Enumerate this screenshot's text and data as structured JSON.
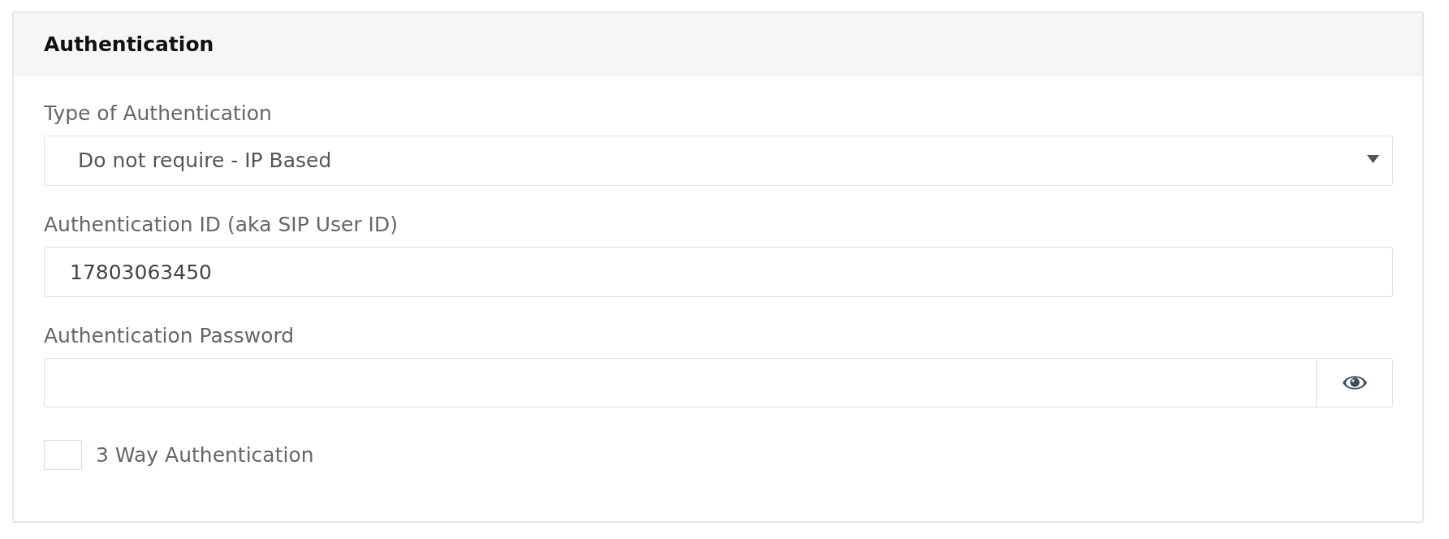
{
  "card": {
    "title": "Authentication"
  },
  "fields": [
    {
      "kind": "select",
      "label": "Type of Authentication",
      "value": "Do not require - IP Based"
    },
    {
      "kind": "text",
      "label": "Authentication ID (aka SIP User ID)",
      "value": "17803063450"
    },
    {
      "kind": "password",
      "label": "Authentication Password"
    }
  ],
  "checkbox": {
    "label": "3 Way Authentication",
    "checked": false
  }
}
